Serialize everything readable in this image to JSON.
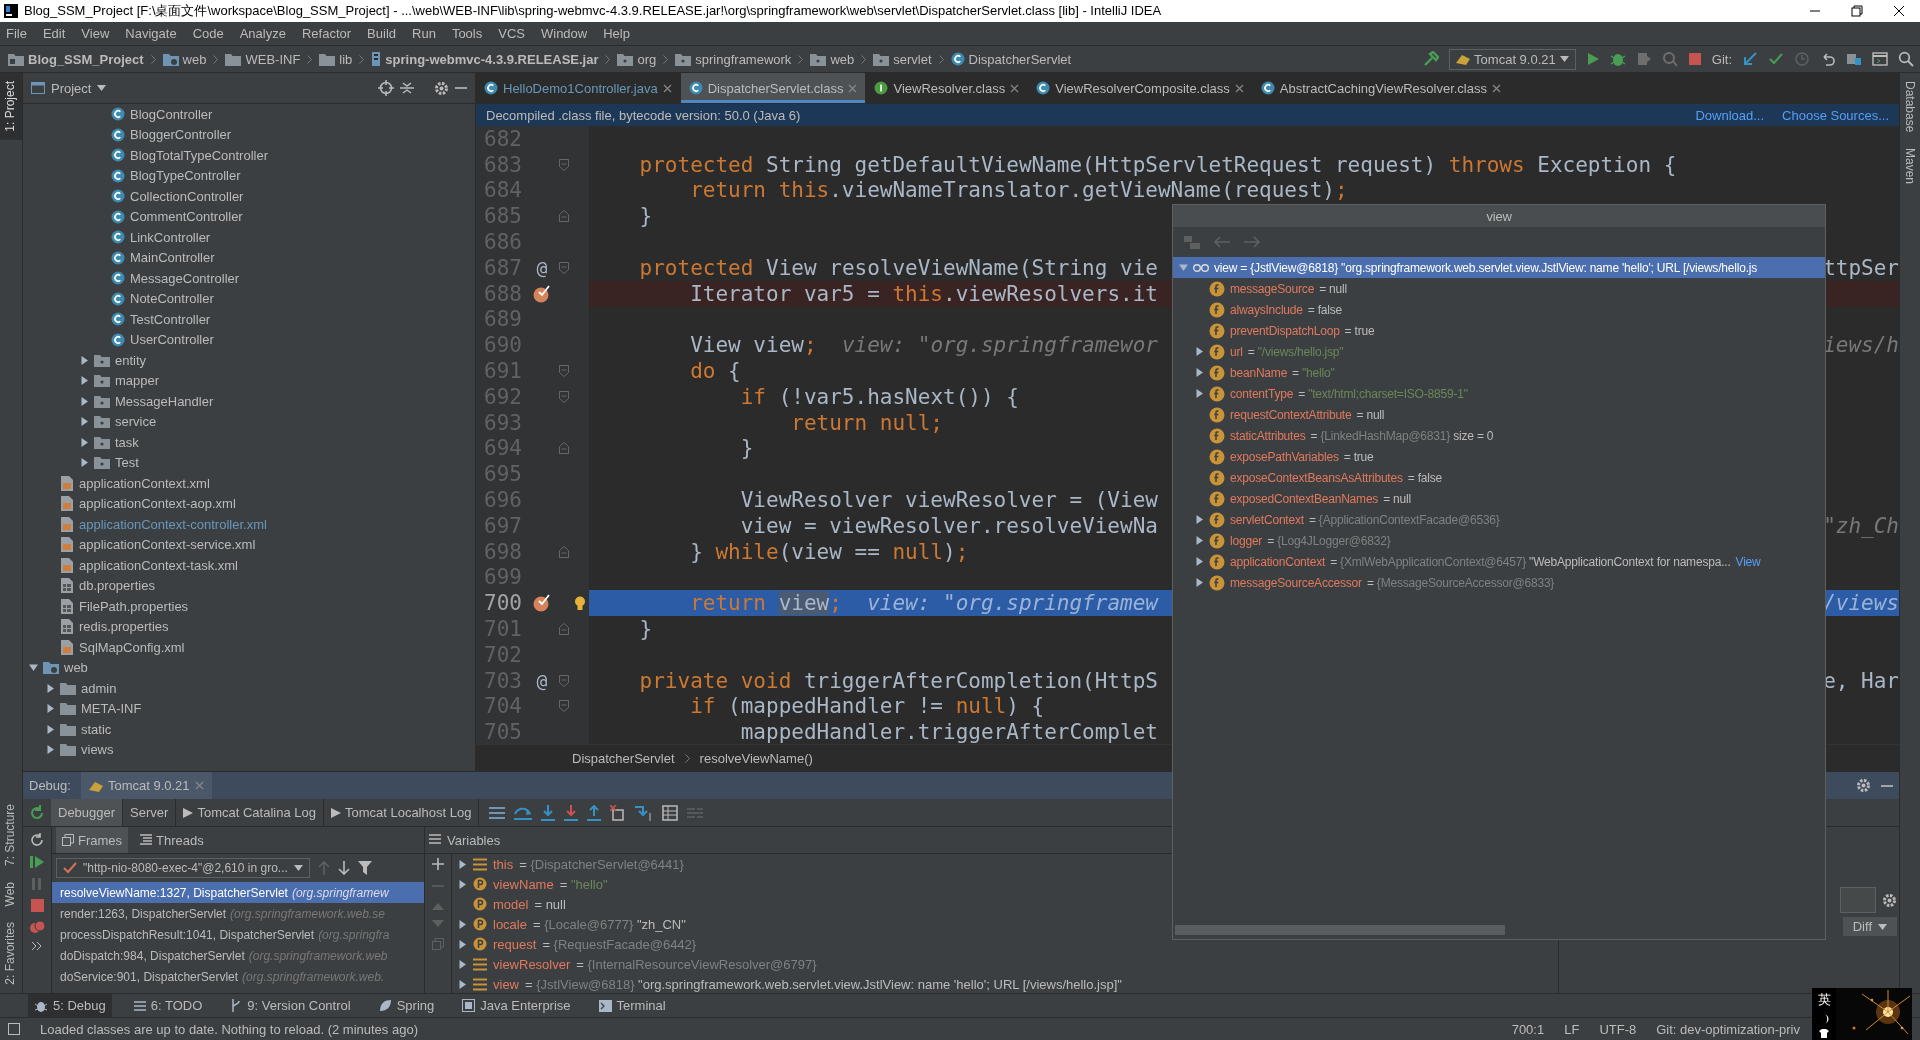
{
  "window": {
    "title": "Blog_SSM_Project [F:\\桌面文件\\workspace\\Blog_SSM_Project] - ...\\web\\WEB-INF\\lib\\spring-webmvc-4.3.9.RELEASE.jar!\\org\\springframework\\web\\servlet\\DispatcherServlet.class [lib] - IntelliJ IDEA"
  },
  "menu": [
    "File",
    "Edit",
    "View",
    "Navigate",
    "Code",
    "Analyze",
    "Refactor",
    "Build",
    "Run",
    "Tools",
    "VCS",
    "Window",
    "Help"
  ],
  "nav": {
    "crumbs": [
      {
        "label": "Blog_SSM_Project",
        "kind": "project"
      },
      {
        "label": "web",
        "kind": "webfolder"
      },
      {
        "label": "WEB-INF",
        "kind": "folder"
      },
      {
        "label": "lib",
        "kind": "folder"
      },
      {
        "label": "spring-webmvc-4.3.9.RELEASE.jar",
        "kind": "jar"
      },
      {
        "label": "org",
        "kind": "package"
      },
      {
        "label": "springframework",
        "kind": "package"
      },
      {
        "label": "web",
        "kind": "package"
      },
      {
        "label": "servlet",
        "kind": "package"
      },
      {
        "label": "DispatcherServlet",
        "kind": "class"
      }
    ],
    "run_config": "Tomcat 9.0.21",
    "git_label": "Git:"
  },
  "left_stripe": [
    {
      "label": "1: Project",
      "selected": true
    },
    {
      "label": "7: Structure",
      "selected": false
    },
    {
      "label": "Web",
      "selected": false
    },
    {
      "label": "2: Favorites",
      "selected": false
    }
  ],
  "right_stripe": [
    {
      "label": "Database"
    },
    {
      "label": "Maven"
    }
  ],
  "project_panel": {
    "title": "Project",
    "tree": [
      {
        "children": [
          {
            "children": [
              {
                "children": [
                  {
                    "children": [
                      {
                        "label": "BlogController",
                        "kind": "class"
                      },
                      {
                        "label": "BloggerController",
                        "kind": "class"
                      },
                      {
                        "label": "BlogTotalTypeController",
                        "kind": "class"
                      },
                      {
                        "label": "BlogTypeController",
                        "kind": "class"
                      },
                      {
                        "label": "CollectionController",
                        "kind": "class"
                      },
                      {
                        "label": "CommentController",
                        "kind": "class"
                      },
                      {
                        "label": "LinkController",
                        "kind": "class"
                      },
                      {
                        "label": "MainController",
                        "kind": "class"
                      },
                      {
                        "label": "MessageController",
                        "kind": "class"
                      },
                      {
                        "label": "NoteController",
                        "kind": "class"
                      },
                      {
                        "label": "TestController",
                        "kind": "class"
                      },
                      {
                        "label": "UserController",
                        "kind": "class"
                      }
                    ]
                  },
                  {
                    "label": "entity",
                    "kind": "package",
                    "expanded": false
                  },
                  {
                    "label": "mapper",
                    "kind": "package",
                    "expanded": false
                  },
                  {
                    "label": "MessageHandler",
                    "kind": "package",
                    "expanded": false
                  },
                  {
                    "label": "service",
                    "kind": "package",
                    "expanded": false
                  },
                  {
                    "label": "task",
                    "kind": "package",
                    "expanded": false
                  },
                  {
                    "label": "Test",
                    "kind": "package",
                    "expanded": false
                  }
                ]
              }
            ]
          },
          {
            "label": "applicationContext.xml",
            "kind": "xml",
            "modified": false
          },
          {
            "label": "applicationContext-aop.xml",
            "kind": "xml",
            "modified": false
          },
          {
            "label": "applicationContext-controller.xml",
            "kind": "xml",
            "modified": true
          },
          {
            "label": "applicationContext-service.xml",
            "kind": "xml",
            "modified": false
          },
          {
            "label": "applicationContext-task.xml",
            "kind": "xml",
            "modified": false
          },
          {
            "label": "db.properties",
            "kind": "properties"
          },
          {
            "label": "FilePath.properties",
            "kind": "properties"
          },
          {
            "label": "redis.properties",
            "kind": "properties"
          },
          {
            "label": "SqlMapConfig.xml",
            "kind": "xml",
            "modified": false
          }
        ]
      },
      {
        "label": "web",
        "kind": "webfolder",
        "expanded": true,
        "children": [
          {
            "label": "admin",
            "kind": "folder",
            "expanded": false
          },
          {
            "label": "META-INF",
            "kind": "folder",
            "expanded": false
          },
          {
            "label": "static",
            "kind": "folder",
            "expanded": false
          },
          {
            "label": "views",
            "kind": "folder",
            "expanded": false
          }
        ]
      }
    ]
  },
  "editor": {
    "tabs": [
      {
        "label": "HelloDemo1Controller.java",
        "kind": "class",
        "modified": true,
        "selected": false
      },
      {
        "label": "DispatcherServlet.class",
        "kind": "class",
        "modified": false,
        "selected": true
      },
      {
        "label": "ViewResolver.class",
        "kind": "interface",
        "modified": false,
        "selected": false
      },
      {
        "label": "ViewResolverComposite.class",
        "kind": "class",
        "modified": false,
        "selected": false
      },
      {
        "label": "AbstractCachingViewResolver.class",
        "kind": "class",
        "modified": false,
        "selected": false
      }
    ],
    "notice": {
      "text": "Decompiled .class file, bytecode version: 50.0 (Java 6)",
      "links": [
        "Download...",
        "Choose Sources..."
      ]
    },
    "lines": [
      {
        "n": "682"
      },
      {
        "n": "683",
        "fold_start": true,
        "code": [
          {
            "kind": "kw",
            "text": "    protected"
          },
          {
            "kind": "id",
            "text": " String getDefaultViewName(HttpServletRequest request) "
          },
          {
            "kind": "kw",
            "text": "throws"
          },
          {
            "kind": "id",
            "text": " Exception {"
          }
        ]
      },
      {
        "n": "684",
        "code": [
          {
            "kind": "kw",
            "text": "        return this"
          },
          {
            "kind": "id",
            "text": ".viewNameTranslator.getViewName(request)"
          },
          {
            "kind": "kw",
            "text": ";"
          }
        ]
      },
      {
        "n": "685",
        "fold_end": true,
        "code": [
          {
            "kind": "id",
            "text": "    }"
          }
        ]
      },
      {
        "n": "686"
      },
      {
        "n": "687",
        "mark": "@",
        "fold_start": true,
        "code": [
          {
            "kind": "kw",
            "text": "    protected"
          },
          {
            "kind": "id",
            "text": " View resolveViewName(String vie"
          }
        ],
        "tail": [
          {
            "kind": "id",
            "text": "ttpSer"
          }
        ]
      },
      {
        "n": "688",
        "breakpoint": true,
        "code": [
          {
            "kind": "id",
            "text": "        Iterator var5 = "
          },
          {
            "kind": "kw",
            "text": "this"
          },
          {
            "kind": "id",
            "text": ".viewResolvers.it"
          }
        ]
      },
      {
        "n": "689"
      },
      {
        "n": "690",
        "code": [
          {
            "kind": "id",
            "text": "        View view"
          },
          {
            "kind": "kw",
            "text": ";"
          },
          {
            "kind": "hint",
            "text": "  view: \"org.springframewor"
          }
        ],
        "tail": [
          {
            "kind": "hint",
            "text": "iews/h"
          }
        ]
      },
      {
        "n": "691",
        "fold_start": true,
        "code": [
          {
            "kind": "kw",
            "text": "        do"
          },
          {
            "kind": "id",
            "text": " {"
          }
        ]
      },
      {
        "n": "692",
        "fold_start": true,
        "code": [
          {
            "kind": "kw",
            "text": "            if"
          },
          {
            "kind": "id",
            "text": " (!var5.hasNext()) {"
          }
        ]
      },
      {
        "n": "693",
        "code": [
          {
            "kind": "kw",
            "text": "                return null;"
          }
        ]
      },
      {
        "n": "694",
        "fold_end": true,
        "code": [
          {
            "kind": "id",
            "text": "            }"
          }
        ]
      },
      {
        "n": "695"
      },
      {
        "n": "696",
        "code": [
          {
            "kind": "id",
            "text": "            ViewResolver viewResolver = (View"
          }
        ]
      },
      {
        "n": "697",
        "code": [
          {
            "kind": "id",
            "text": "            view = viewResolver.resolveViewNa"
          }
        ],
        "tail": [
          {
            "kind": "hint",
            "text": "\"zh_Ch"
          }
        ]
      },
      {
        "n": "698",
        "fold_end": true,
        "code": [
          {
            "kind": "id",
            "text": "        } "
          },
          {
            "kind": "kw",
            "text": "while"
          },
          {
            "kind": "id",
            "text": "(view == "
          },
          {
            "kind": "kw",
            "text": "null"
          },
          {
            "kind": "id",
            "text": ")"
          },
          {
            "kind": "kw",
            "text": ";"
          }
        ]
      },
      {
        "n": "699"
      },
      {
        "n": "700",
        "breakpoint": true,
        "current": true,
        "bulb": true,
        "code": [
          {
            "kind": "kw",
            "text": "        return "
          },
          {
            "kind": "hl",
            "text": "view"
          },
          {
            "kind": "kw",
            "text": ";"
          },
          {
            "kind": "hint",
            "text": "  view: \"org.springframew"
          }
        ],
        "tail": [
          {
            "kind": "hint",
            "text": "/views"
          }
        ]
      },
      {
        "n": "701",
        "fold_end": true,
        "code": [
          {
            "kind": "id",
            "text": "    }"
          }
        ]
      },
      {
        "n": "702"
      },
      {
        "n": "703",
        "mark": "@",
        "fold_start": true,
        "code": [
          {
            "kind": "kw",
            "text": "    private void"
          },
          {
            "kind": "id",
            "text": " triggerAfterCompletion(HttpS"
          }
        ],
        "tail": [
          {
            "kind": "id",
            "text": "e, Har"
          }
        ]
      },
      {
        "n": "704",
        "fold_start": true,
        "code": [
          {
            "kind": "kw",
            "text": "        if"
          },
          {
            "kind": "id",
            "text": " (mappedHandler != "
          },
          {
            "kind": "kw",
            "text": "null"
          },
          {
            "kind": "id",
            "text": ") {"
          }
        ]
      },
      {
        "n": "705",
        "code": [
          {
            "kind": "id",
            "text": "            mappedHandler.triggerAfterComplet"
          }
        ]
      }
    ],
    "breadcrumbs": [
      "DispatcherServlet",
      "resolveViewName()"
    ]
  },
  "debug": {
    "label": "Debug:",
    "session_tab": "Tomcat 9.0.21",
    "tabs": [
      {
        "label": "Debugger",
        "selected": true
      },
      {
        "label": "Server",
        "selected": false
      },
      {
        "label": "Tomcat Catalina Log",
        "selected": false
      },
      {
        "label": "Tomcat Localhost Log",
        "selected": false
      }
    ],
    "frame_tabs": [
      {
        "label": "Frames",
        "selected": true
      },
      {
        "label": "Threads",
        "selected": false
      }
    ],
    "thread": "\"http-nio-8080-exec-4\"@2,610 in gro...",
    "frames": [
      {
        "method": "resolveViewName:1327, DispatcherServlet",
        "package": "(org.springframew",
        "selected": true
      },
      {
        "method": "render:1263, DispatcherServlet",
        "package": "(org.springframework.web.se",
        "selected": false
      },
      {
        "method": "processDispatchResult:1041, DispatcherServlet",
        "package": "(org.springfra",
        "selected": false
      },
      {
        "method": "doDispatch:984, DispatcherServlet",
        "package": "(org.springframework.web",
        "selected": false
      },
      {
        "method": "doService:901, DispatcherServlet",
        "package": "(org.springframework.web.",
        "selected": false
      }
    ],
    "variables_title": "Variables",
    "variables": [
      {
        "kind": "fields",
        "name": "this",
        "expanded": false,
        "value": [
          {
            "kind": "lit",
            "text": "= "
          },
          {
            "kind": "obj",
            "text": "{DispatcherServlet@6441}"
          }
        ]
      },
      {
        "kind": "param",
        "name": "viewName",
        "expanded": false,
        "value": [
          {
            "kind": "lit",
            "text": "= "
          },
          {
            "kind": "str",
            "text": "\"hello\""
          }
        ]
      },
      {
        "kind": "param",
        "name": "model",
        "value": [
          {
            "kind": "lit",
            "text": "= null"
          }
        ]
      },
      {
        "kind": "param",
        "name": "locale",
        "expanded": false,
        "value": [
          {
            "kind": "lit",
            "text": "= "
          },
          {
            "kind": "obj",
            "text": "{Locale@6777}"
          },
          {
            "kind": "lit",
            "text": " \"zh_CN\""
          }
        ]
      },
      {
        "kind": "param",
        "name": "request",
        "expanded": false,
        "value": [
          {
            "kind": "lit",
            "text": "= "
          },
          {
            "kind": "obj",
            "text": "{RequestFacade@6442}"
          }
        ]
      },
      {
        "kind": "fields",
        "name": "viewResolver",
        "expanded": false,
        "value": [
          {
            "kind": "lit",
            "text": "= "
          },
          {
            "kind": "obj",
            "text": "{InternalResourceViewResolver@6797}"
          }
        ]
      },
      {
        "kind": "fields",
        "name": "view",
        "expanded": false,
        "value": [
          {
            "kind": "lit",
            "text": "= "
          },
          {
            "kind": "obj",
            "text": "{JstlView@6818}"
          },
          {
            "kind": "lit",
            "text": " \"org.springframework.web.servlet.view.JstlView: name 'hello'; URL [/views/hello.jsp]\""
          }
        ]
      }
    ],
    "diff_label": "Diff"
  },
  "popup": {
    "title": "view",
    "root": {
      "name": "view",
      "expanded": true,
      "selected": true,
      "value": "= {JstlView@6818} \"org.springframework.web.servlet.view.JstlView: name 'hello'; URL [/views/hello.js"
    },
    "fields": [
      {
        "name": "messageSource",
        "value": [
          {
            "kind": "lit",
            "text": "= null"
          }
        ]
      },
      {
        "name": "alwaysInclude",
        "value": [
          {
            "kind": "lit",
            "text": "= false"
          }
        ]
      },
      {
        "name": "preventDispatchLoop",
        "value": [
          {
            "kind": "lit",
            "text": "= true"
          }
        ]
      },
      {
        "name": "url",
        "expanded": false,
        "value": [
          {
            "kind": "lit",
            "text": "= "
          },
          {
            "kind": "str",
            "text": "\"/views/hello.jsp\""
          }
        ]
      },
      {
        "name": "beanName",
        "expanded": false,
        "value": [
          {
            "kind": "lit",
            "text": "= "
          },
          {
            "kind": "str",
            "text": "\"hello\""
          }
        ]
      },
      {
        "name": "contentType",
        "expanded": false,
        "value": [
          {
            "kind": "lit",
            "text": "= "
          },
          {
            "kind": "str",
            "text": "\"text/html;charset=ISO-8859-1\""
          }
        ]
      },
      {
        "name": "requestContextAttribute",
        "value": [
          {
            "kind": "lit",
            "text": "= null"
          }
        ]
      },
      {
        "name": "staticAttributes",
        "value": [
          {
            "kind": "lit",
            "text": "= "
          },
          {
            "kind": "obj",
            "text": "{LinkedHashMap@6831}"
          },
          {
            "kind": "lit",
            "text": "  size = 0"
          }
        ]
      },
      {
        "name": "exposePathVariables",
        "value": [
          {
            "kind": "lit",
            "text": "= true"
          }
        ]
      },
      {
        "name": "exposeContextBeansAsAttributes",
        "value": [
          {
            "kind": "lit",
            "text": "= false"
          }
        ]
      },
      {
        "name": "exposedContextBeanNames",
        "value": [
          {
            "kind": "lit",
            "text": "= null"
          }
        ]
      },
      {
        "name": "servletContext",
        "expanded": false,
        "value": [
          {
            "kind": "lit",
            "text": "= "
          },
          {
            "kind": "obj",
            "text": "{ApplicationContextFacade@6536}"
          }
        ]
      },
      {
        "name": "logger",
        "expanded": false,
        "value": [
          {
            "kind": "lit",
            "text": "= "
          },
          {
            "kind": "obj",
            "text": "{Log4JLogger@6832}"
          }
        ]
      },
      {
        "name": "applicationContext",
        "expanded": false,
        "value": [
          {
            "kind": "lit",
            "text": "= "
          },
          {
            "kind": "obj",
            "text": "{XmlWebApplicationContext@6457}"
          },
          {
            "kind": "lit",
            "text": " \"WebApplicationContext for namespa..."
          }
        ],
        "link": "View"
      },
      {
        "name": "messageSourceAccessor",
        "expanded": false,
        "value": [
          {
            "kind": "lit",
            "text": "= "
          },
          {
            "kind": "obj",
            "text": "{MessageSourceAccessor@6833}"
          }
        ]
      }
    ]
  },
  "tool_windows": [
    {
      "label": "5: Debug",
      "kind": "bug",
      "selected": true
    },
    {
      "label": "6: TODO",
      "kind": "list",
      "selected": false
    },
    {
      "label": "9: Version Control",
      "kind": "vcs",
      "selected": false
    },
    {
      "label": "Spring",
      "kind": "leaf",
      "selected": false
    },
    {
      "label": "Java Enterprise",
      "kind": "je",
      "selected": false
    },
    {
      "label": "Terminal",
      "kind": "term",
      "selected": false
    }
  ],
  "status_bar": {
    "message": "Loaded classes are up to date. Nothing to reload. (2 minutes ago)",
    "position": "700:1",
    "line_separator": "LF",
    "encoding": "UTF-8",
    "git": "Git: dev-optimization-priv"
  },
  "ime": {
    "label": "英",
    "kind": "picture"
  }
}
